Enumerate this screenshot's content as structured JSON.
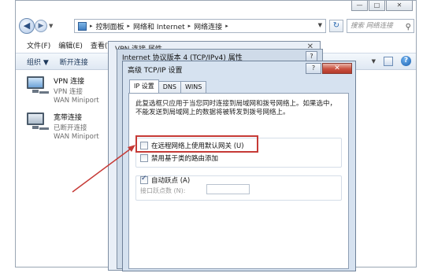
{
  "window": {
    "controls": {
      "minimize": "—",
      "maximize": "□",
      "close": "✕"
    }
  },
  "address_bar": {
    "back_glyph": "◀",
    "forward_glyph": "▶",
    "crumbs": [
      "控制面板",
      "网络和 Internet",
      "网络连接"
    ],
    "separator": "▸",
    "refresh_glyph": "↻",
    "search_placeholder": "搜索 网络连接"
  },
  "menu": [
    "文件(F)",
    "编辑(E)",
    "查看(V"
  ],
  "toolbar": {
    "organize": "组织 ▼",
    "disable": "断开连接",
    "help": "?"
  },
  "connections": [
    {
      "name": "VPN 连接",
      "status": "VPN 连接",
      "device": "WAN Miniport"
    },
    {
      "name": "宽带连接",
      "status": "已断开连接",
      "device": "WAN Miniport"
    }
  ],
  "dialogs": {
    "vpn_props_title": "VPN 连接 属性",
    "ipv4_title": "Internet 协议版本 4 (TCP/IPv4) 属性",
    "ipv4_help": "?",
    "back_close": "✕"
  },
  "advanced": {
    "title": "高级 TCP/IP 设置",
    "help": "?",
    "close": "✕",
    "tabs": [
      "IP 设置",
      "DNS",
      "WINS"
    ],
    "description": "此复选框只应用于当您同时连接到局域网和拨号网络上。如果选中，不能发送到局域网上的数据将被转发到拨号网络上。",
    "use_default_gateway": {
      "label": "在远程网络上使用默认网关 (U)",
      "checked": false
    },
    "disable_class_route": {
      "label": "禁用基于类的路由添加",
      "checked": false
    },
    "auto_metric": {
      "label": "自动跃点 (A)",
      "checked": true
    },
    "interface_metric_label": "接口跃点数 (N):",
    "interface_metric_value": ""
  },
  "colors": {
    "highlight": "#c63a36",
    "dialog_bg": "#d6e2f0",
    "close_button": "#c9503f"
  }
}
